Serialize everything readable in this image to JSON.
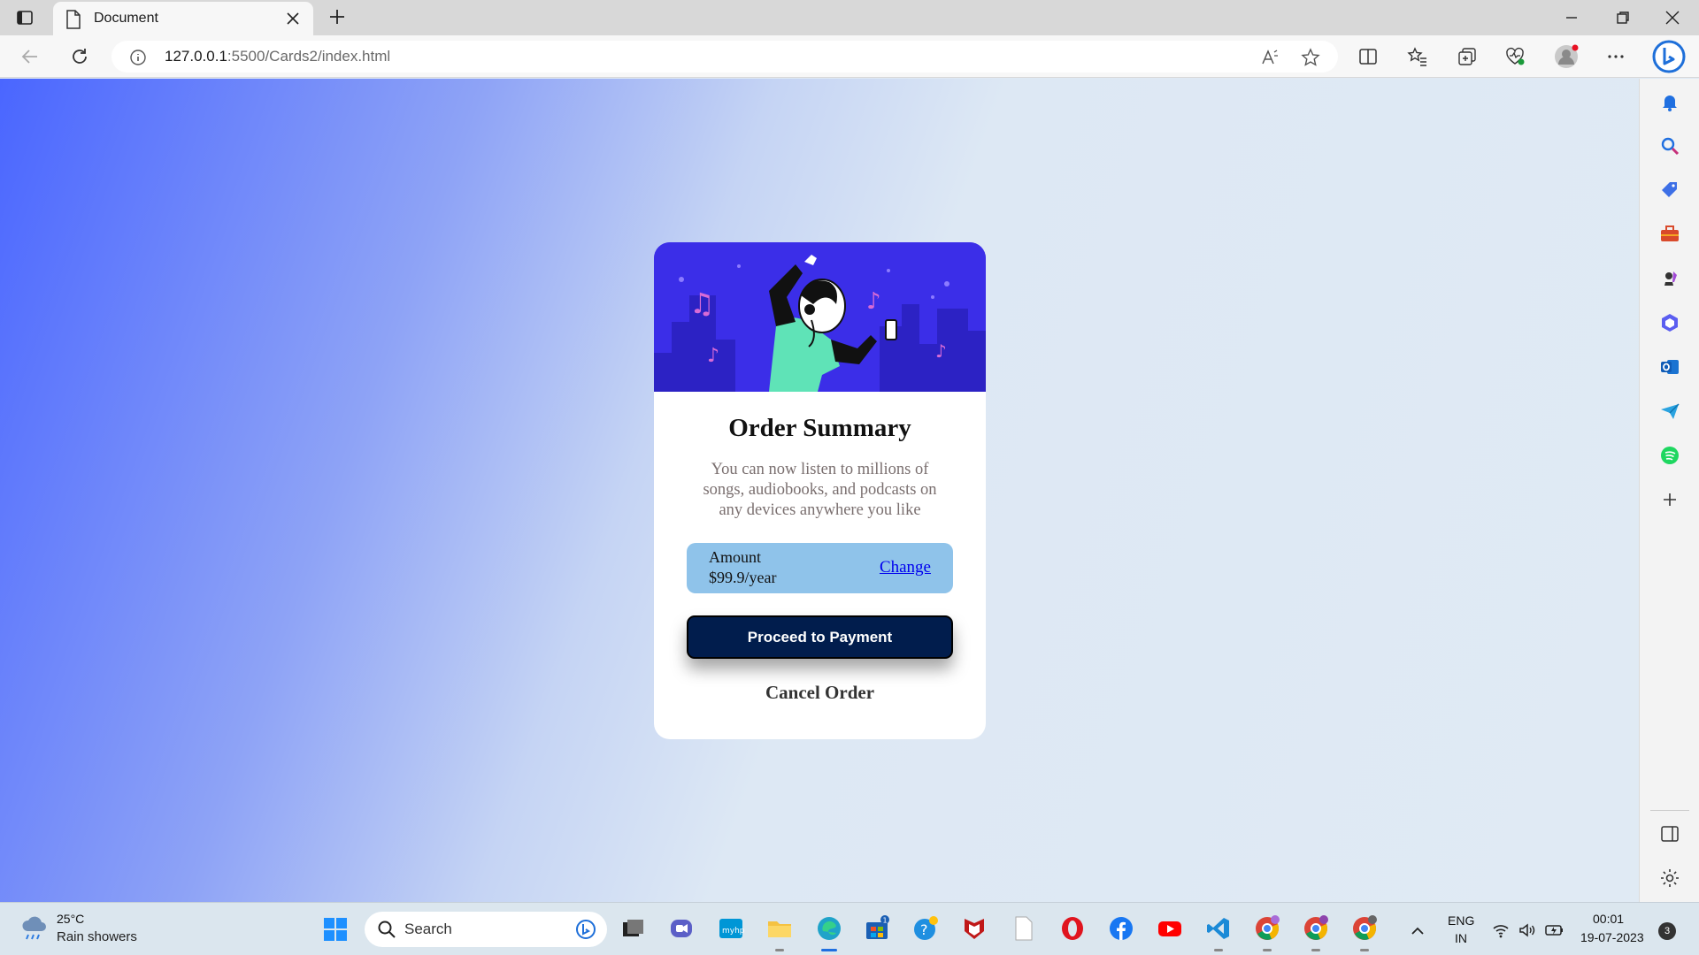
{
  "browser": {
    "tab_title": "Document",
    "url_host": "127.0.0.1",
    "url_rest": ":5500/Cards2/index.html"
  },
  "card": {
    "title": "Order Summary",
    "description": "You can now listen to millions of songs, audiobooks, and podcasts on any devices anywhere you like",
    "amount_label": "Amount",
    "amount_value": "$99.9/year",
    "change_link": "Change",
    "pay_button": "Proceed to Payment",
    "cancel_button": "Cancel Order"
  },
  "taskbar": {
    "weather_temp": "25°C",
    "weather_desc": "Rain showers",
    "search_placeholder": "Search",
    "language_top": "ENG",
    "language_bottom": "IN",
    "time": "00:01",
    "date": "19-07-2023",
    "notification_count": "3",
    "store_badge": "1"
  },
  "colors": {
    "hero": "#3b2ee8",
    "amount_box": "#8fc3ea",
    "pay_button": "#011d4d",
    "gradient_left": "#4a66ff"
  }
}
